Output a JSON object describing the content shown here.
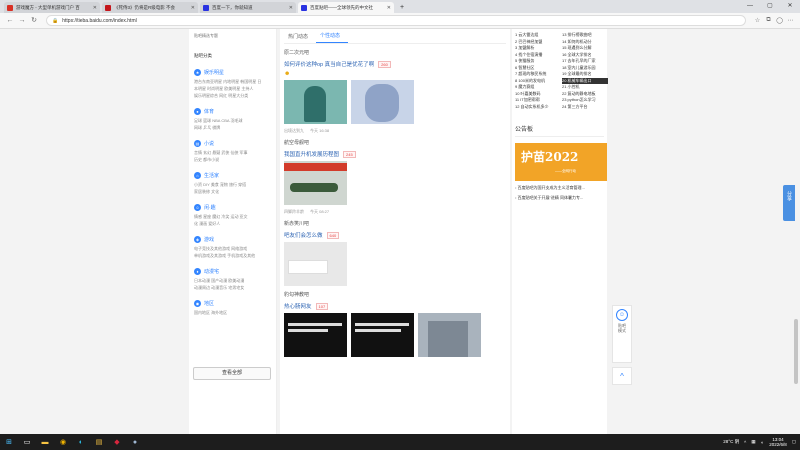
{
  "browser": {
    "tabs": [
      {
        "title": "游戏魔方 - 大型单机游戏门户 百",
        "fav_color": "#d93025",
        "active": false
      },
      {
        "title": "《死侍3》仍将是R级电影 不会",
        "fav_color": "#c4161c",
        "active": false
      },
      {
        "title": "百度一下，你就知道",
        "fav_color": "#2932e1",
        "active": false
      },
      {
        "title": "百度贴吧——全球领先的中文社",
        "fav_color": "#2932e1",
        "active": true
      }
    ],
    "new_tab_glyph": "+",
    "url": "https://tieba.baidu.com/index.html"
  },
  "left": {
    "top_text": "贴吧精选专题",
    "heading": "贴吧分类",
    "categories": [
      {
        "title": "娱乐明星",
        "icon": "star-icon",
        "lines": [
          "港台东南亚明星  内地明星  韩国明星  日",
          "本明星  时尚明星  欧美明星  主持人",
          "娱乐明星综合  网红  明星大分类"
        ]
      },
      {
        "title": "体育",
        "icon": "ball-icon",
        "lines": [
          "足球  篮球  NBA  CBA  羽毛球",
          "网球  乒乓  棋牌"
        ]
      },
      {
        "title": "小说",
        "icon": "book-icon",
        "lines": [
          "言情  玄幻  悬疑  武侠  仙侠  军事",
          "历史  都市小说"
        ]
      },
      {
        "title": "生活家",
        "icon": "home-icon",
        "lines": [
          "小资  DIY  美食  宠物  旅行  穿搭",
          "家居装修  文化"
        ]
      },
      {
        "title": "闲·趣",
        "icon": "smile-icon",
        "lines": [
          "情感  星座  魔幻  冷笑  运动  亚文",
          "化  漫画  爱好人"
        ]
      },
      {
        "title": "游戏",
        "icon": "gamepad-icon",
        "lines": [
          "电子竞技及其他游戏  网络游戏",
          "单机游戏及其游戏  手机游戏及其他"
        ]
      },
      {
        "title": "动漫宅",
        "icon": "anime-icon",
        "lines": [
          "日本动漫  国产动漫  欧美动漫",
          "动漫周边  动漫音乐  宅男宅女"
        ]
      },
      {
        "title": "地区",
        "icon": "location-icon",
        "lines": [
          "国内地区  海外地区"
        ]
      }
    ],
    "view_all": "查看全部"
  },
  "feed": {
    "tabs": [
      "热门动态",
      "个性动态"
    ],
    "active_tab": 1,
    "items": [
      {
        "forum": "原二次元吧",
        "title": "如何评价这种op 真当自己是优花了啊",
        "reply_count": "260",
        "has_emoji": true,
        "thumbs": [
          "#7bb7b0",
          "#c8d4e8"
        ],
        "meta": [
          "出境达到九",
          "今天 16:38"
        ]
      },
      {
        "forum": "航空母舰吧",
        "title": "我国直升机发展历程图",
        "reply_count": "245",
        "has_emoji": false,
        "thumbs": [
          "#cfd6d0"
        ],
        "meta": [
          "四脚羚羊龄",
          "今天 08:27"
        ]
      },
      {
        "forum": "新赤笑川吧",
        "title": "吧友们会怎么做",
        "reply_count": "640",
        "has_emoji": false,
        "thumbs": [
          "#e8e8e8"
        ],
        "meta": []
      },
      {
        "forum": "豹勾神教吧",
        "title": "热心肠网友",
        "reply_count": "107",
        "has_emoji": false,
        "thumbs": [
          "#111111",
          "#111111",
          "#a9b3bd"
        ],
        "meta": []
      }
    ]
  },
  "right": {
    "ranks_left": [
      "1 云大雷达组",
      "2 巴巴神经加盟",
      "3 加盟解析",
      "4 找个住宿演播",
      "5 侠猫服务",
      "6 智慧社区",
      "7 超现的移民系统",
      "8 100米的发电机",
      "9 魔力赛组",
      "10 叶嘉美数码",
      "11 IT加密帮帮",
      "12 自动实系机多少"
    ],
    "ranks_right": [
      "13 排行榜歌曲吧",
      "14 如何的机动分",
      "15 现遇到么分解",
      "16 全球大学排名",
      "17 去年孔早的厂家",
      "18 室内儿童游乐园",
      "19 全球最的排名",
      "20 机械车辆出口",
      "21 小控机",
      "22 复动的静电地板",
      "23 python怎么学习",
      "24 第三方平台"
    ],
    "highlight_index": 7,
    "section_title": "公告板",
    "banner_title": "护苗2022",
    "banner_sub": "——全网行动",
    "links": [
      "百度贴吧为国开支成为主义活育管理...",
      "百度贴吧关于开展\"进精 同体暑力专..."
    ]
  },
  "widgets": {
    "share": "分享",
    "assist": "贴吧\n模式",
    "back_top": "^"
  },
  "taskbar": {
    "weather": "28°C  阴",
    "time": "13:04",
    "date": "2022/6/8"
  }
}
